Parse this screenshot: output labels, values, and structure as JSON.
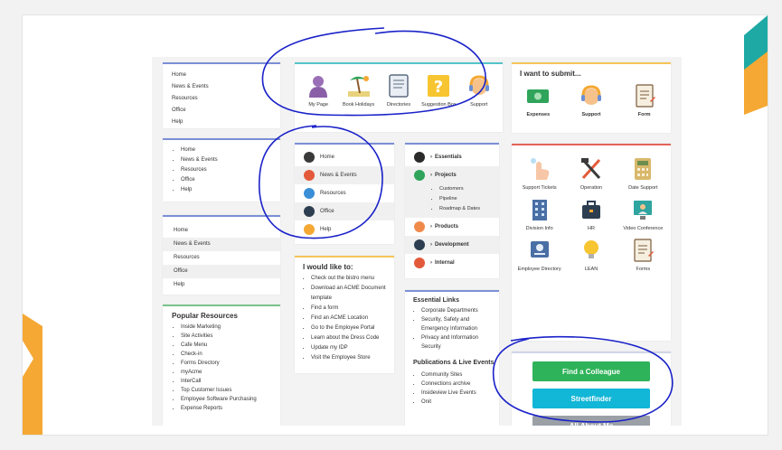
{
  "menus": {
    "menu1": [
      "Home",
      "News & Events",
      "Resources",
      "Office",
      "Help"
    ],
    "menu2": [
      "Home",
      "News & Events",
      "Resources",
      "Office",
      "Help"
    ],
    "menu3": [
      "Home",
      "News & Events",
      "Resources",
      "Office",
      "Help"
    ]
  },
  "popular": {
    "title": "Popular Resources",
    "items": [
      "Inside Marketing",
      "Site Activities",
      "Cafe Menu",
      "Check-in",
      "Forms Directory",
      "myAcme",
      "InterCall",
      "Top Customer Issues",
      "Employee Software Purchasing",
      "Expense Reports"
    ]
  },
  "quicklinks": [
    {
      "label": "My Page",
      "icon": "person-icon"
    },
    {
      "label": "Book Holidays",
      "icon": "beach-icon"
    },
    {
      "label": "Directories",
      "icon": "directory-icon"
    },
    {
      "label": "Suggestion Box",
      "icon": "question-box-icon"
    },
    {
      "label": "Support",
      "icon": "headset-icon"
    }
  ],
  "navmenu": [
    "Home",
    "News & Events",
    "Resources",
    "Office",
    "Help"
  ],
  "would_like": {
    "title": "I would like to:",
    "items": [
      "Check out the bistro menu",
      "Download an ACME Document template",
      "Find a form",
      "Find an ACME Location",
      "Go to the Employee Portal",
      "Learn about the Dress Code",
      "Update my IDP",
      "Visit the Employee Store"
    ]
  },
  "tree": {
    "essentials": "Essentials",
    "projects": "Projects",
    "project_children": [
      "Customers",
      "Pipeline",
      "Roadmap & Dates"
    ],
    "products": "Products",
    "development": "Development",
    "internal": "Internal"
  },
  "essential_links": {
    "title": "Essential Links",
    "items": [
      "Corporate Departments",
      "Security, Safety and Emergency Information",
      "Privacy and Information Security"
    ]
  },
  "publications": {
    "title": "Publications & Live Events",
    "items": [
      "Community Sites",
      "Connections archive",
      "Insideview Live Events",
      "Onit"
    ]
  },
  "submit": {
    "title": "I want to submit...",
    "items": [
      {
        "label": "Expenses",
        "icon": "money-icon"
      },
      {
        "label": "Support",
        "icon": "headset-icon"
      },
      {
        "label": "Form",
        "icon": "form-icon"
      }
    ]
  },
  "apps": [
    {
      "label": "Support Tickets",
      "icon": "hand-icon"
    },
    {
      "label": "Operation",
      "icon": "tools-icon"
    },
    {
      "label": "Date Support",
      "icon": "calculator-icon"
    },
    {
      "label": "Division Info",
      "icon": "building-icon"
    },
    {
      "label": "HR",
      "icon": "briefcase-icon"
    },
    {
      "label": "Video Conference",
      "icon": "video-icon"
    },
    {
      "label": "Employee Directory",
      "icon": "id-badge-icon"
    },
    {
      "label": "LEAN",
      "icon": "lightbulb-icon"
    },
    {
      "label": "Forms",
      "icon": "form-icon"
    }
  ],
  "buttons": {
    "find": "Find a Colleague",
    "street": "Streetfinder",
    "about": "All About Me"
  },
  "colors": {
    "accent_teal": "#1ea9a4",
    "accent_orange": "#f5a833",
    "annotation_blue": "#1a22c8",
    "btn_green": "#2fb35a",
    "btn_cyan": "#12b6d6",
    "btn_gray": "#9aa0a6"
  }
}
